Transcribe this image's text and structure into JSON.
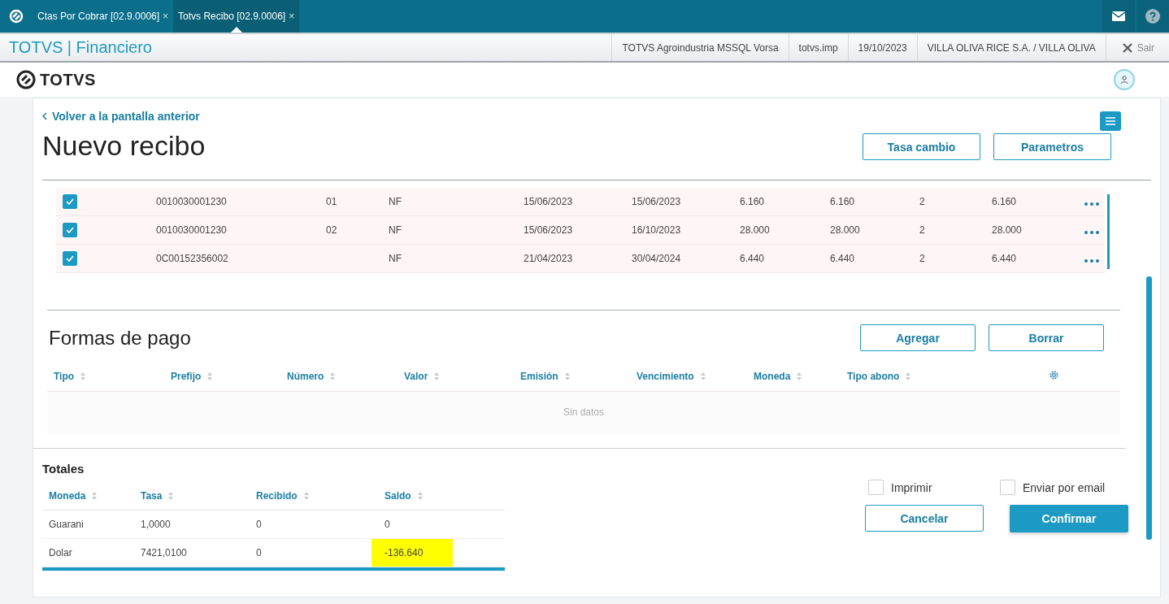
{
  "tabs": [
    {
      "label": "Ctas Por Cobrar [02.9.0006]",
      "close": "×",
      "selected": false
    },
    {
      "label": "Totvs Recibo [02.9.0006]",
      "close": "×",
      "selected": true
    }
  ],
  "header": {
    "title": "TOTVS | Financiero",
    "info": [
      "TOTVS Agroindustria MSSQL Vorsa",
      "totvs.imp",
      "19/10/2023",
      "VILLA OLIVA RICE S.A. / VILLA OLIVA"
    ],
    "exit": "Sair"
  },
  "brand": "TOTVS",
  "page": {
    "back_link": "Volver a la pantalla anterior",
    "title": "Nuevo recibo",
    "buttons": [
      "Tasa cambio",
      "Parametros"
    ]
  },
  "titles": {
    "rows": [
      {
        "checked": true,
        "cells": [
          "0010030001230",
          "01",
          "NF",
          "15/06/2023",
          "15/06/2023",
          "6.160",
          "6.160",
          "2",
          "6.160"
        ]
      },
      {
        "checked": true,
        "cells": [
          "0010030001230",
          "02",
          "NF",
          "15/06/2023",
          "16/10/2023",
          "28.000",
          "28.000",
          "2",
          "28.000"
        ]
      },
      {
        "checked": true,
        "cells": [
          "0C00152356002",
          "",
          "NF",
          "21/04/2023",
          "30/04/2024",
          "6.440",
          "6.440",
          "2",
          "6.440"
        ]
      }
    ]
  },
  "payments": {
    "title": "Formas de pago",
    "buttons": [
      "Agregar",
      "Borrar"
    ],
    "columns": [
      "Tipo",
      "Prefijo",
      "Número",
      "Valor",
      "Emisión",
      "Vencimiento",
      "Moneda",
      "Tipo abono"
    ],
    "empty": "Sin datos"
  },
  "totals": {
    "title": "Totales",
    "columns": [
      "Moneda",
      "Tasa",
      "Recibido",
      "Saldo"
    ],
    "rows": [
      {
        "highlighted": false,
        "cells": [
          "Guarani",
          "1,0000",
          "0",
          "0"
        ]
      },
      {
        "highlighted": true,
        "cells": [
          "Dolar",
          "7421,0100",
          "0",
          "-136.640"
        ]
      }
    ]
  },
  "options": [
    {
      "label": "Imprimir",
      "checked": false
    },
    {
      "label": "Enviar por email",
      "checked": false
    }
  ],
  "actions": [
    {
      "label": "Cancelar",
      "kind": "secondary"
    },
    {
      "label": "Confirmar",
      "kind": "primary"
    }
  ]
}
